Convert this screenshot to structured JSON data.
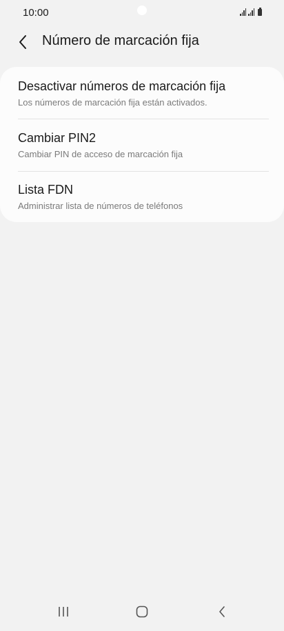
{
  "status_bar": {
    "time": "10:00"
  },
  "header": {
    "back_icon": "chevron-left-icon",
    "title": "Número de marcación fija"
  },
  "list": {
    "items": [
      {
        "title": "Desactivar números de marcación fija",
        "subtitle": "Los números de marcación fija están activados."
      },
      {
        "title": "Cambiar PIN2",
        "subtitle": "Cambiar PIN de acceso de marcación fija"
      },
      {
        "title": "Lista FDN",
        "subtitle": "Administrar lista de números de teléfonos"
      }
    ]
  },
  "nav_bar": {
    "recents_icon": "recents-icon",
    "home_icon": "home-icon",
    "back_icon": "back-icon"
  },
  "colors": {
    "background": "#f2f2f2",
    "card": "#fcfcfc",
    "text_primary": "#1a1a1a",
    "text_secondary": "#7a7a7a"
  }
}
